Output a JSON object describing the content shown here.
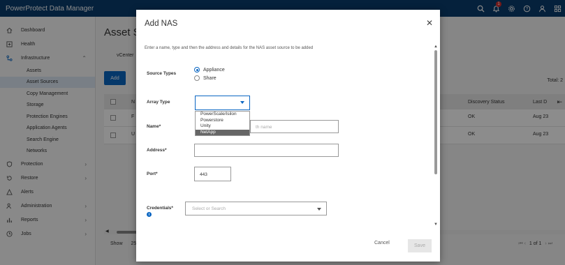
{
  "app": {
    "title": "PowerProtect Data Manager",
    "notification_count": "1"
  },
  "sidebar": {
    "items": [
      {
        "label": "Dashboard",
        "icon": "home-icon"
      },
      {
        "label": "Health",
        "icon": "health-icon"
      },
      {
        "label": "Infrastructure",
        "icon": "infrastructure-icon",
        "expanded": true
      },
      {
        "label": "Protection",
        "icon": "shield-icon"
      },
      {
        "label": "Restore",
        "icon": "restore-icon"
      },
      {
        "label": "Alerts",
        "icon": "alert-icon"
      },
      {
        "label": "Administration",
        "icon": "admin-icon"
      },
      {
        "label": "Reports",
        "icon": "reports-icon"
      },
      {
        "label": "Jobs",
        "icon": "jobs-icon"
      }
    ],
    "sub_items": [
      "Assets",
      "Asset Sources",
      "Copy Management",
      "Storage",
      "Protection Engines",
      "Application Agents",
      "Search Engine",
      "Networks"
    ],
    "active_sub": "Asset Sources"
  },
  "main": {
    "title": "Asset S",
    "tab": "vCenter",
    "add_label": "Add",
    "total": "Total: 2",
    "columns": [
      "N",
      "Discovery Status",
      "Last D"
    ],
    "rows": [
      {
        "name": "F",
        "status": "OK",
        "last": "Aug 23"
      },
      {
        "name": "U",
        "status": "OK",
        "last": "Aug 23"
      }
    ],
    "show_label": "Show",
    "show_value": "25",
    "pager_text": "1 of 1"
  },
  "modal": {
    "title": "Add NAS",
    "description": "Enter a name, type and then the address and details for the NAS asset source to be added",
    "source_types_label": "Source Types",
    "source_options": [
      "Appliance",
      "Share"
    ],
    "source_selected": "Appliance",
    "array_type_label": "Array Type",
    "array_options": [
      "PowerScale/Isilon",
      "Powerstore",
      "Unity",
      "NetApp"
    ],
    "array_highlighted": "NetApp",
    "name_label": "Name*",
    "name_placeholder": "th name",
    "address_label": "Address*",
    "address_value": "",
    "port_label": "Port*",
    "port_value": "443",
    "credentials_label": "Credentials*",
    "credentials_placeholder": "Select or Search",
    "cancel_label": "Cancel",
    "save_label": "Save"
  }
}
